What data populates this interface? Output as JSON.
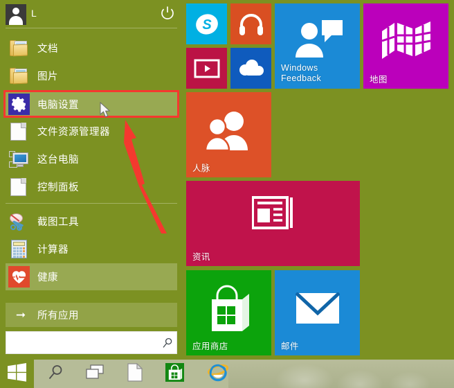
{
  "user": {
    "name": "L",
    "avatar_icon": "user-avatar-icon",
    "power_icon": "power-icon"
  },
  "menu": {
    "items": [
      {
        "label": "文档",
        "icon": "folder-documents-icon",
        "highlighted": false
      },
      {
        "label": "图片",
        "icon": "folder-pictures-icon",
        "highlighted": false
      },
      {
        "label": "电脑设置",
        "icon": "gear-settings-icon",
        "highlighted": true
      },
      {
        "label": "文件资源管理器",
        "icon": "file-explorer-icon",
        "highlighted": false
      },
      {
        "label": "这台电脑",
        "icon": "this-pc-monitor-icon",
        "highlighted": false
      },
      {
        "label": "控制面板",
        "icon": "control-panel-icon",
        "highlighted": false
      },
      {
        "label": "截图工具",
        "icon": "snipping-tool-icon",
        "highlighted": false
      },
      {
        "label": "计算器",
        "icon": "calculator-icon",
        "highlighted": false
      },
      {
        "label": "健康",
        "icon": "health-heart-icon",
        "highlighted": false
      }
    ],
    "all_apps": {
      "label": "所有应用",
      "icon": "arrow-right-icon"
    }
  },
  "search": {
    "value": "",
    "placeholder": "",
    "icon": "search-magnifier-icon"
  },
  "tiles": [
    {
      "name": "skype",
      "label": "",
      "icon": "skype-icon",
      "color": "#00b0e3"
    },
    {
      "name": "music",
      "label": "",
      "icon": "headphones-icon",
      "color": "#d94f22"
    },
    {
      "name": "video",
      "label": "",
      "icon": "video-play-icon",
      "color": "#bb1345"
    },
    {
      "name": "onedrive",
      "label": "",
      "icon": "cloud-icon",
      "color": "#0f5bbd"
    },
    {
      "name": "windows-feedback",
      "label": "Windows\nFeedback",
      "icon": "feedback-person-icon",
      "color": "#1b8ad6"
    },
    {
      "name": "maps",
      "label": "地图",
      "icon": "map-folded-icon",
      "color": "#bb00bb"
    },
    {
      "name": "people",
      "label": "人脉",
      "icon": "people-icon",
      "color": "#dd5128"
    },
    {
      "name": "news",
      "label": "资讯",
      "icon": "news-article-icon",
      "color": "#c0134b"
    },
    {
      "name": "store",
      "label": "应用商店",
      "icon": "store-bag-icon",
      "color": "#0ca30c"
    },
    {
      "name": "mail",
      "label": "邮件",
      "icon": "mail-envelope-icon",
      "color": "#1b8ad6"
    }
  ],
  "taskbar": {
    "start": {
      "icon": "windows-logo-icon"
    },
    "items": [
      {
        "name": "search",
        "icon": "search-magnifier-icon"
      },
      {
        "name": "task-view",
        "icon": "task-view-icon"
      },
      {
        "name": "file-explorer",
        "icon": "file-page-icon"
      },
      {
        "name": "store",
        "icon": "store-bag-icon"
      },
      {
        "name": "internet-explorer",
        "icon": "internet-explorer-icon"
      }
    ]
  },
  "annotations": {
    "highlight_box_color": "#f5382f",
    "arrow_color": "#f5382f",
    "cursor_icon": "mouse-pointer-icon"
  },
  "theme": {
    "accent": "#7c9122",
    "taskbar": "#b6bc98"
  }
}
